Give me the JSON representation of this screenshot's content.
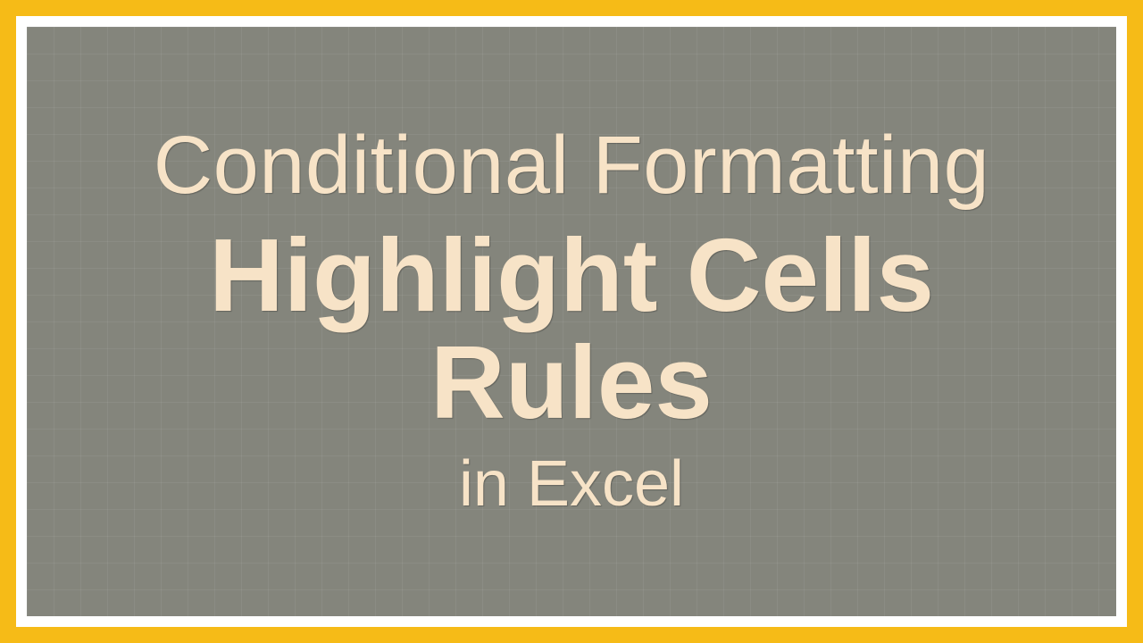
{
  "title": {
    "line1": "Conditional Formatting",
    "line2": "Highlight Cells",
    "line3": "Rules",
    "line4": "in Excel"
  },
  "colors": {
    "outer_border": "#f6bb17",
    "inner_border": "#ffffff",
    "background": "#84857c",
    "text": "#f7e3c7"
  }
}
